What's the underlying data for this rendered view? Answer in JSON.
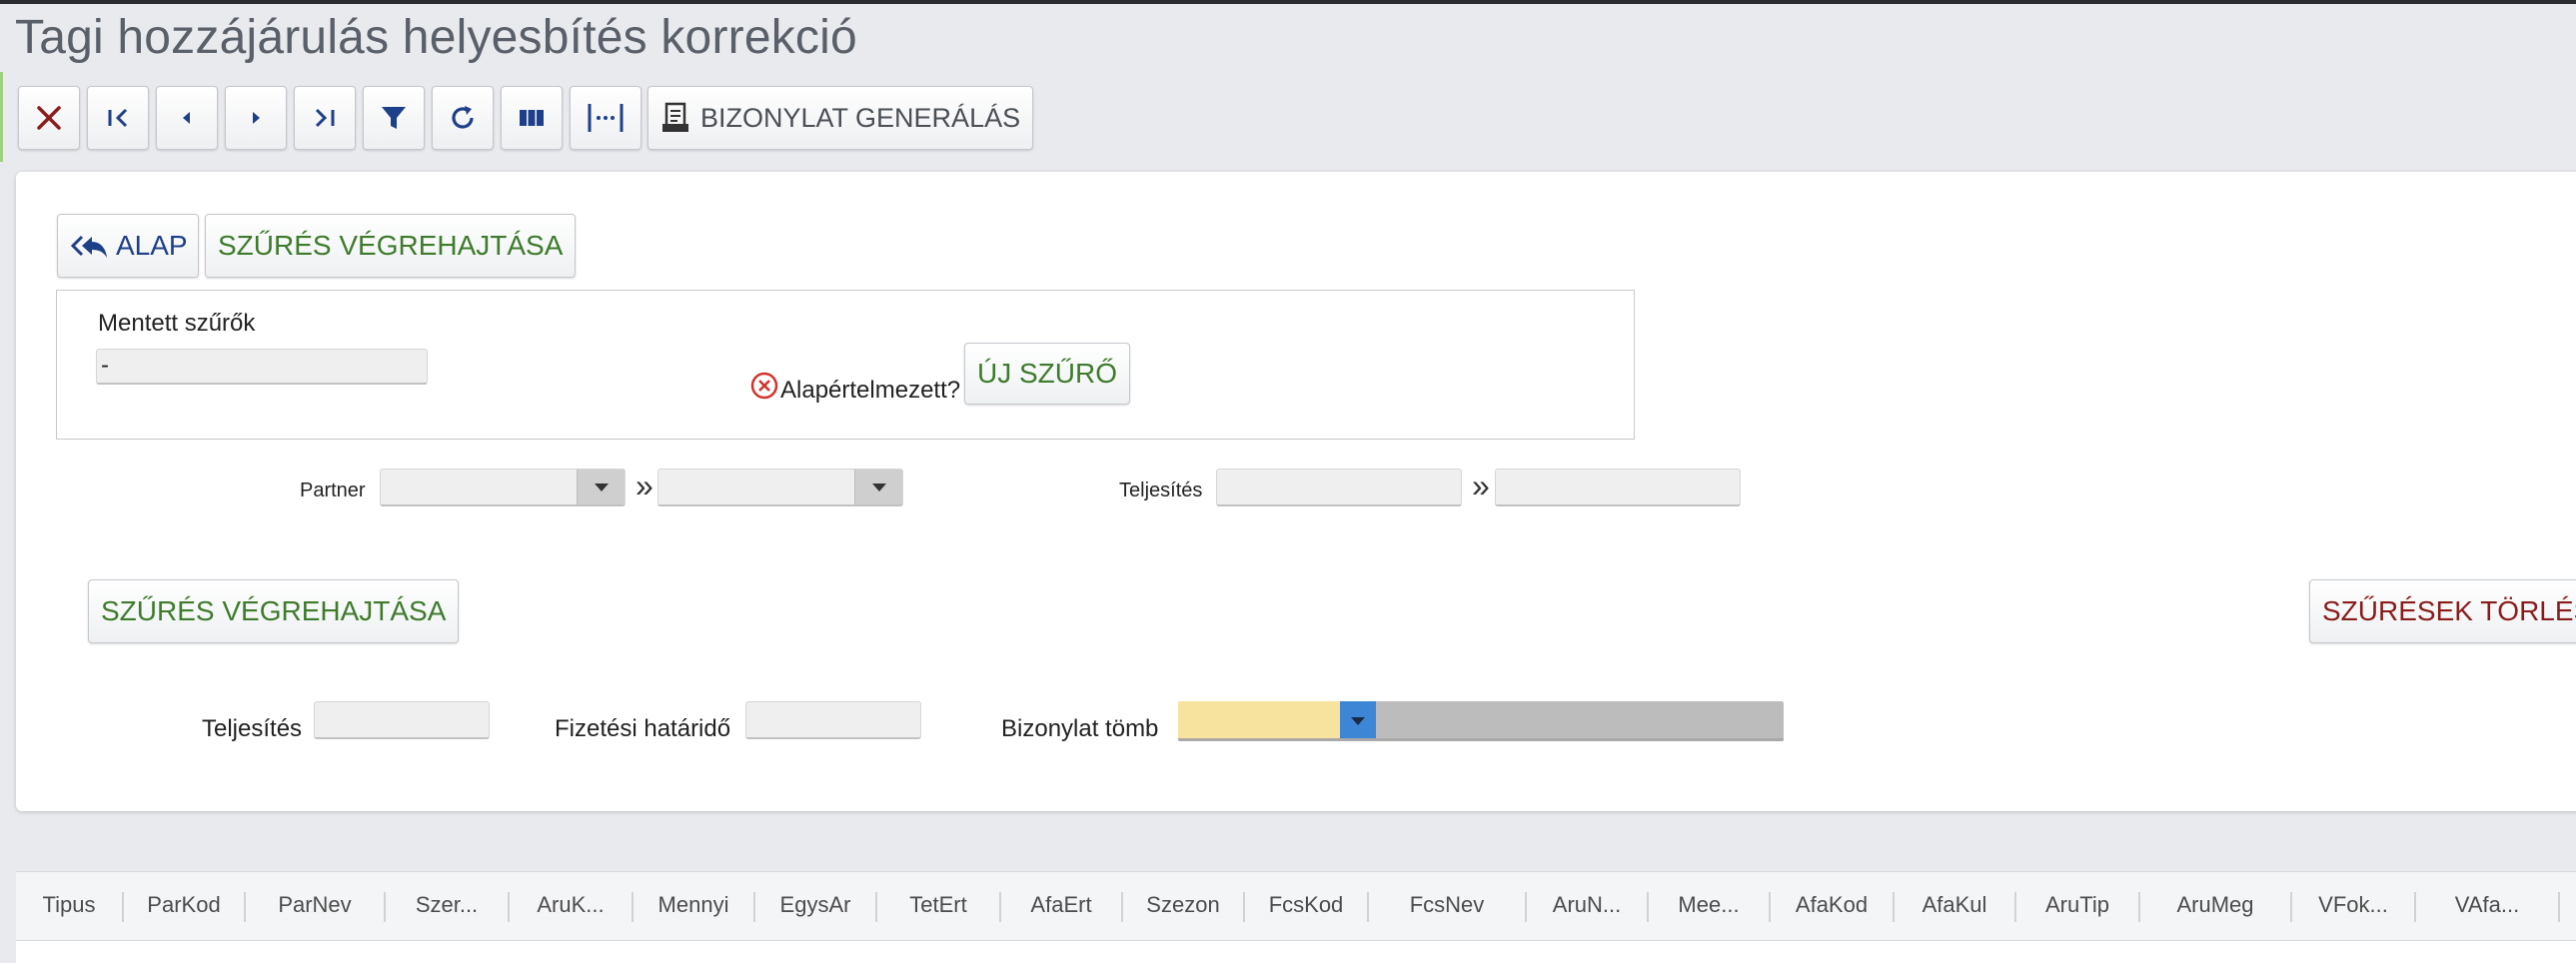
{
  "page": {
    "title": "Tagi hozzájárulás helyesbítés korrekció"
  },
  "toolbar": {
    "buttons": [
      {
        "name": "close",
        "icon": "close-icon"
      },
      {
        "name": "first",
        "icon": "first-record-icon"
      },
      {
        "name": "prev",
        "icon": "previous-record-icon"
      },
      {
        "name": "next",
        "icon": "next-record-icon"
      },
      {
        "name": "last",
        "icon": "last-record-icon"
      },
      {
        "name": "filter",
        "icon": "filter-icon"
      },
      {
        "name": "refresh",
        "icon": "refresh-icon"
      },
      {
        "name": "columns",
        "icon": "columns-icon"
      },
      {
        "name": "column-width",
        "icon": "column-width-icon"
      }
    ],
    "generate_label": "BIZONYLAT GENERÁLÁS",
    "generate_icon": "document-print-icon"
  },
  "filter_panel": {
    "alap_label": "ALAP",
    "alap_icon": "reply-all-icon",
    "execute_label_top": "SZŰRÉS VÉGREHAJTÁSA",
    "saved_filters": {
      "label": "Mentett szűrők",
      "value": "-",
      "default_label": "Alapértelmezett?",
      "default_icon": "circle-x-icon",
      "new_filter_label": "ÚJ SZŰRŐ"
    },
    "partner_label": "Partner",
    "range_separator": "»",
    "teljesites_label": "Teljesítés",
    "execute_label_bottom": "SZŰRÉSEK TÖRLÉS",
    "execute_label": "SZŰRÉS VÉGREHAJTÁSA"
  },
  "params": {
    "teljesites_label": "Teljesítés",
    "fizetesi_hatarido_label": "Fizetési határidő",
    "bizonylat_tomb_label": "Bizonylat tömb"
  },
  "grid": {
    "columns": [
      "Tipus",
      "ParKod",
      "ParNev",
      "Szer...",
      "AruK...",
      "Mennyi",
      "EgysAr",
      "TetErt",
      "AfaErt",
      "Szezon",
      "FcsKod",
      "FcsNev",
      "AruN...",
      "Mee...",
      "AfaKod",
      "AfaKul",
      "AruTip",
      "AruMeg",
      "VFok...",
      "VAfa..."
    ]
  },
  "colors": {
    "green_text": "#3e7b2b",
    "red_text": "#8a1c1c",
    "blue_text": "#1e3f8a",
    "combo_yellow": "#f7e29e",
    "combo_blue": "#3d86d6"
  }
}
